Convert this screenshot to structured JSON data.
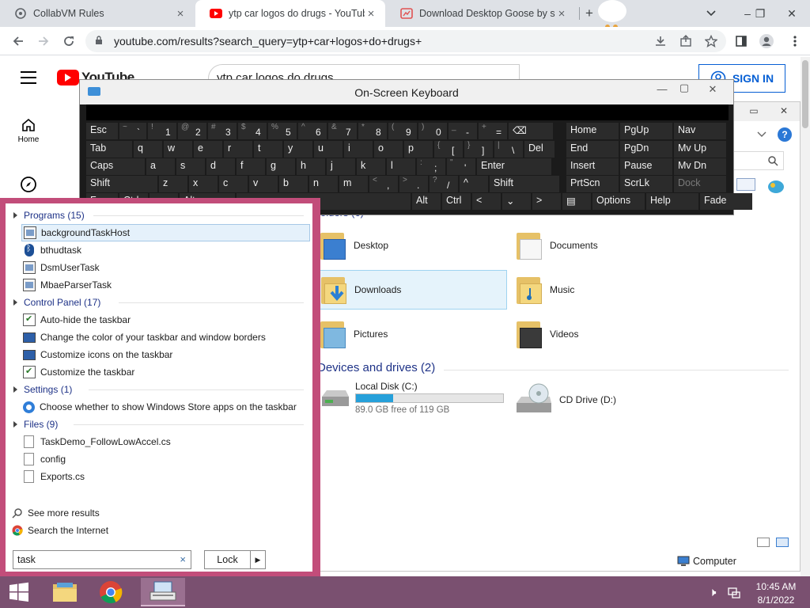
{
  "browser": {
    "tabs": [
      {
        "title": "CollabVM Rules",
        "close": "×"
      },
      {
        "title": "ytp car logos do drugs - YouTube",
        "close": "×"
      },
      {
        "title": "Download Desktop Goose by sam",
        "close": "×"
      }
    ],
    "new_tab": "+",
    "address": "youtube.com/results?search_query=ytp+car+logos+do+drugs+",
    "window_controls": {
      "minimize": "–",
      "restore": "❐",
      "close": "✕"
    }
  },
  "youtube": {
    "logo": "YouTube",
    "search_query": "ytp car logos do drugs",
    "sign_in": "SIGN IN",
    "sidebar": [
      {
        "label": "Home",
        "icon": "home-icon"
      },
      {
        "label": "",
        "icon": "explore-icon"
      }
    ]
  },
  "osk": {
    "title": "On-Screen Keyboard",
    "controls": {
      "minimize": "—",
      "maximize": "▢",
      "close": "✕"
    },
    "rows": [
      [
        {
          "main": "Esc"
        },
        {
          "shift": "~",
          "main": "`"
        },
        {
          "shift": "!",
          "main": "1"
        },
        {
          "shift": "@",
          "main": "2"
        },
        {
          "shift": "#",
          "main": "3"
        },
        {
          "shift": "$",
          "main": "4"
        },
        {
          "shift": "%",
          "main": "5"
        },
        {
          "shift": "^",
          "main": "6"
        },
        {
          "shift": "&",
          "main": "7"
        },
        {
          "shift": "*",
          "main": "8"
        },
        {
          "shift": "(",
          "main": "9"
        },
        {
          "shift": ")",
          "main": "0"
        },
        {
          "shift": "_",
          "main": "-"
        },
        {
          "shift": "+",
          "main": "="
        },
        {
          "main": "⌫"
        },
        {
          "main": "Home"
        },
        {
          "main": "PgUp"
        },
        {
          "main": "Nav"
        }
      ],
      [
        {
          "main": "Tab"
        },
        {
          "main": "q"
        },
        {
          "main": "w"
        },
        {
          "main": "e"
        },
        {
          "main": "r"
        },
        {
          "main": "t"
        },
        {
          "main": "y"
        },
        {
          "main": "u"
        },
        {
          "main": "i"
        },
        {
          "main": "o"
        },
        {
          "main": "p"
        },
        {
          "shift": "{",
          "main": "["
        },
        {
          "shift": "}",
          "main": "]"
        },
        {
          "shift": "|",
          "main": "\\"
        },
        {
          "main": "Del"
        },
        {
          "main": "End"
        },
        {
          "main": "PgDn"
        },
        {
          "main": "Mv Up"
        }
      ],
      [
        {
          "main": "Caps"
        },
        {
          "main": "a"
        },
        {
          "main": "s"
        },
        {
          "main": "d"
        },
        {
          "main": "f"
        },
        {
          "main": "g"
        },
        {
          "main": "h"
        },
        {
          "main": "j"
        },
        {
          "main": "k"
        },
        {
          "main": "l"
        },
        {
          "shift": ":",
          "main": ";"
        },
        {
          "shift": "\"",
          "main": "'"
        },
        {
          "main": "Enter"
        },
        {
          "main": "Insert"
        },
        {
          "main": "Pause"
        },
        {
          "main": "Mv Dn"
        }
      ],
      [
        {
          "main": "Shift"
        },
        {
          "main": "z"
        },
        {
          "main": "x"
        },
        {
          "main": "c"
        },
        {
          "main": "v"
        },
        {
          "main": "b"
        },
        {
          "main": "n"
        },
        {
          "main": "m"
        },
        {
          "shift": "<",
          "main": ","
        },
        {
          "shift": ">",
          "main": "."
        },
        {
          "shift": "?",
          "main": "/"
        },
        {
          "main": "^"
        },
        {
          "main": "Shift"
        },
        {
          "main": "PrtScn"
        },
        {
          "main": "ScrLk"
        },
        {
          "main": "Dock"
        }
      ],
      [
        {
          "main": "Fn"
        },
        {
          "main": "Ctrl"
        },
        {
          "main": "⊞"
        },
        {
          "main": "Alt"
        },
        {
          "main": ""
        },
        {
          "main": "Alt"
        },
        {
          "main": "Ctrl"
        },
        {
          "main": "<"
        },
        {
          "main": "⌄"
        },
        {
          "main": ">"
        },
        {
          "main": "▤"
        },
        {
          "main": "Options"
        },
        {
          "main": "Help"
        },
        {
          "main": "Fade"
        }
      ]
    ]
  },
  "explorer": {
    "folders_header_partial": "olders (6)",
    "folders": [
      {
        "name": "Desktop"
      },
      {
        "name": "Documents"
      },
      {
        "name": "Downloads",
        "selected": true
      },
      {
        "name": "Music"
      },
      {
        "name": "Pictures"
      },
      {
        "name": "Videos"
      }
    ],
    "devices_header": "Devices and drives (2)",
    "drives": [
      {
        "name": "Local Disk (C:)",
        "free": "89.0 GB free of 119 GB",
        "used_fraction": 0.25
      },
      {
        "name": "CD Drive (D:)"
      }
    ],
    "status_location": "Computer"
  },
  "search_panel": {
    "categories": [
      {
        "label": "Programs (15)",
        "items": [
          {
            "label": "backgroundTaskHost",
            "icon": "app-icon",
            "selected": true
          },
          {
            "label": "bthudtask",
            "icon": "bluetooth-icon"
          },
          {
            "label": "DsmUserTask",
            "icon": "app-icon"
          },
          {
            "label": "MbaeParserTask",
            "icon": "app-icon"
          }
        ]
      },
      {
        "label": "Control Panel (17)",
        "items": [
          {
            "label": "Auto-hide the taskbar",
            "icon": "checkbox-icon"
          },
          {
            "label": "Change the color of your taskbar and window borders",
            "icon": "monitor-icon"
          },
          {
            "label": "Customize icons on the taskbar",
            "icon": "monitor-icon"
          },
          {
            "label": "Customize the taskbar",
            "icon": "checkbox-icon"
          }
        ]
      },
      {
        "label": "Settings (1)",
        "items": [
          {
            "label": "Choose whether to show Windows Store apps on the taskbar",
            "icon": "gear-icon"
          }
        ]
      },
      {
        "label": "Files (9)",
        "items": [
          {
            "label": "TaskDemo_FollowLowAccel.cs",
            "icon": "file-icon"
          },
          {
            "label": "config",
            "icon": "file-icon"
          },
          {
            "label": "Exports.cs",
            "icon": "file-icon"
          }
        ]
      }
    ],
    "see_more": "See more results",
    "search_internet": "Search the Internet",
    "query": "task",
    "clear": "×",
    "lock_button": "Lock"
  },
  "taskbar": {
    "time": "10:45 AM",
    "date": "8/1/2022",
    "colors": {
      "start_border": "#c24d7a",
      "taskbar": "#7a5070"
    }
  }
}
